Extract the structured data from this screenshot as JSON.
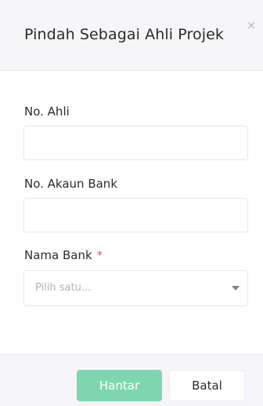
{
  "modal": {
    "title": "Pindah Sebagai Ahli Projek",
    "close_symbol": "×",
    "close_icon": "close-icon"
  },
  "form": {
    "member_no": {
      "label": "No. Ahli",
      "value": "",
      "placeholder": ""
    },
    "bank_account_no": {
      "label": "No. Akaun Bank",
      "value": "",
      "placeholder": ""
    },
    "bank_name": {
      "label": "Nama Bank",
      "required_marker": "*",
      "selected": "Pilih satu...",
      "caret_icon": "chevron-down-icon"
    }
  },
  "footer": {
    "submit_label": "Hantar",
    "cancel_label": "Batal"
  },
  "colors": {
    "primary": "#7fd6ae",
    "required": "#ee5b6b",
    "header_bg": "#f6f6f8"
  }
}
